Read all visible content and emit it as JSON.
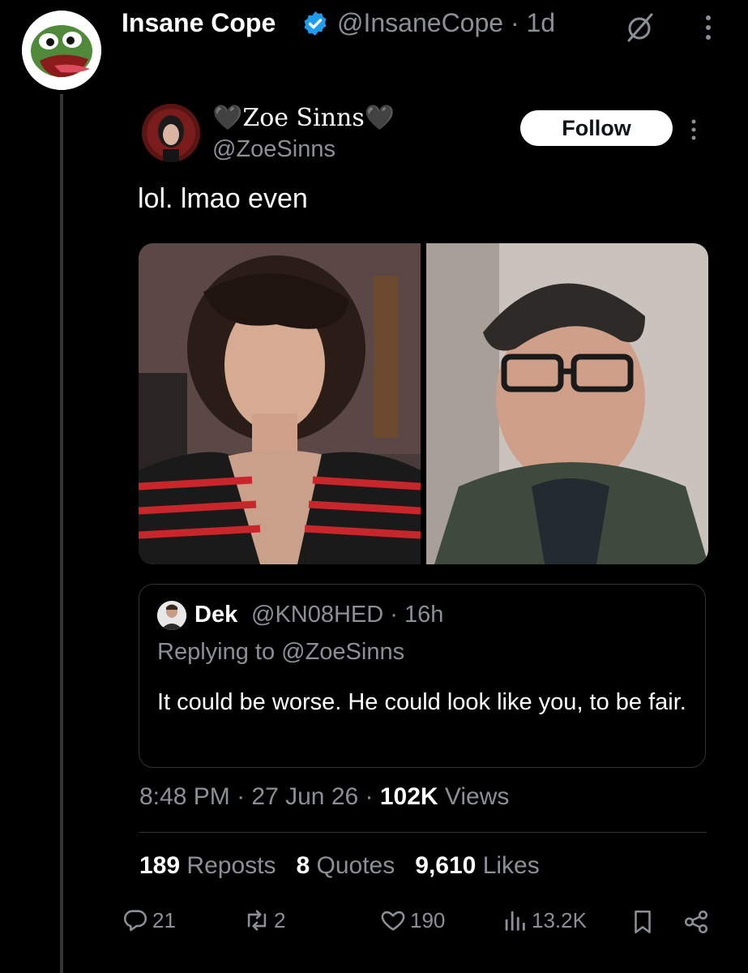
{
  "outer_post": {
    "display_name": "Insane Cope",
    "handle_time": "@InsaneCope · 1d"
  },
  "tweet": {
    "display_name": "🖤Zoe Sinns🖤",
    "handle": "@ZoeSinns",
    "follow_label": "Follow",
    "text": "lol. lmao even"
  },
  "reply": {
    "name": "Dek",
    "handle_time": "@KN08HED · 16h",
    "replying_to": "Replying to @ZoeSinns",
    "text": "It could be worse. He could look like you, to be fair."
  },
  "meta": {
    "time": "8:48 PM",
    "date": "27 Jun 26",
    "views_count": "102K",
    "views_label": "Views"
  },
  "stats": {
    "reposts_count": "189",
    "reposts_label": "Reposts",
    "quotes_count": "8",
    "quotes_label": "Quotes",
    "likes_count": "9,610",
    "likes_label": "Likes"
  },
  "actions": {
    "replies": "21",
    "reposts": "2",
    "likes": "190",
    "views": "13.2K"
  },
  "colors": {
    "background": "#000000",
    "muted": "#8b9096",
    "verified": "#1d9bf0",
    "divider": "#2f3336"
  },
  "icons": [
    "pepe-avatar",
    "verified-badge-icon",
    "grok-icon",
    "more-icon",
    "reply-icon",
    "repost-icon",
    "like-icon",
    "views-icon",
    "bookmark-icon",
    "share-icon"
  ]
}
